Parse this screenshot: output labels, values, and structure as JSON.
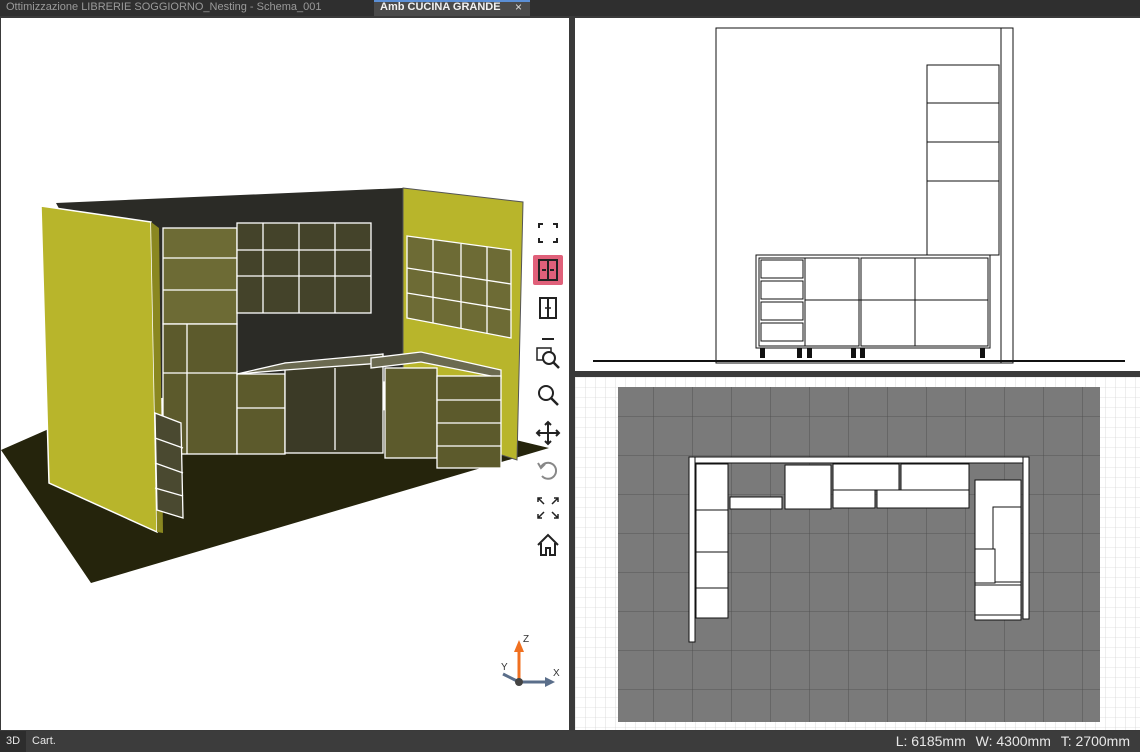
{
  "tabs": [
    {
      "label": "Ottimizzazione LIBRERIE SOGGIORNO_Nesting - Schema_001",
      "active": false
    },
    {
      "label": "Amb CUCINA GRANDE",
      "active": true,
      "close": "×"
    }
  ],
  "toolbar": {
    "tools": [
      {
        "name": "select-region-icon"
      },
      {
        "name": "section-view-icon",
        "active": true
      },
      {
        "name": "split-view-icon"
      },
      {
        "name": "zoom-window-icon"
      },
      {
        "name": "zoom-icon"
      },
      {
        "name": "pan-icon"
      },
      {
        "name": "rotate-icon"
      },
      {
        "name": "fit-extents-icon"
      },
      {
        "name": "home-icon"
      }
    ],
    "active_color": "#e0607a"
  },
  "axes": {
    "x": "X",
    "y": "Y",
    "z": "Z"
  },
  "status": {
    "mode": "3D",
    "coord": "Cart.",
    "length": "L: 6185mm",
    "width": "W: 4300mm",
    "height": "T: 2700mm"
  },
  "colors": {
    "wall": "#b8b52b",
    "wall_dark": "#2b2b26",
    "floor": "#25240c",
    "plan_fill": "#7a7a7a"
  }
}
